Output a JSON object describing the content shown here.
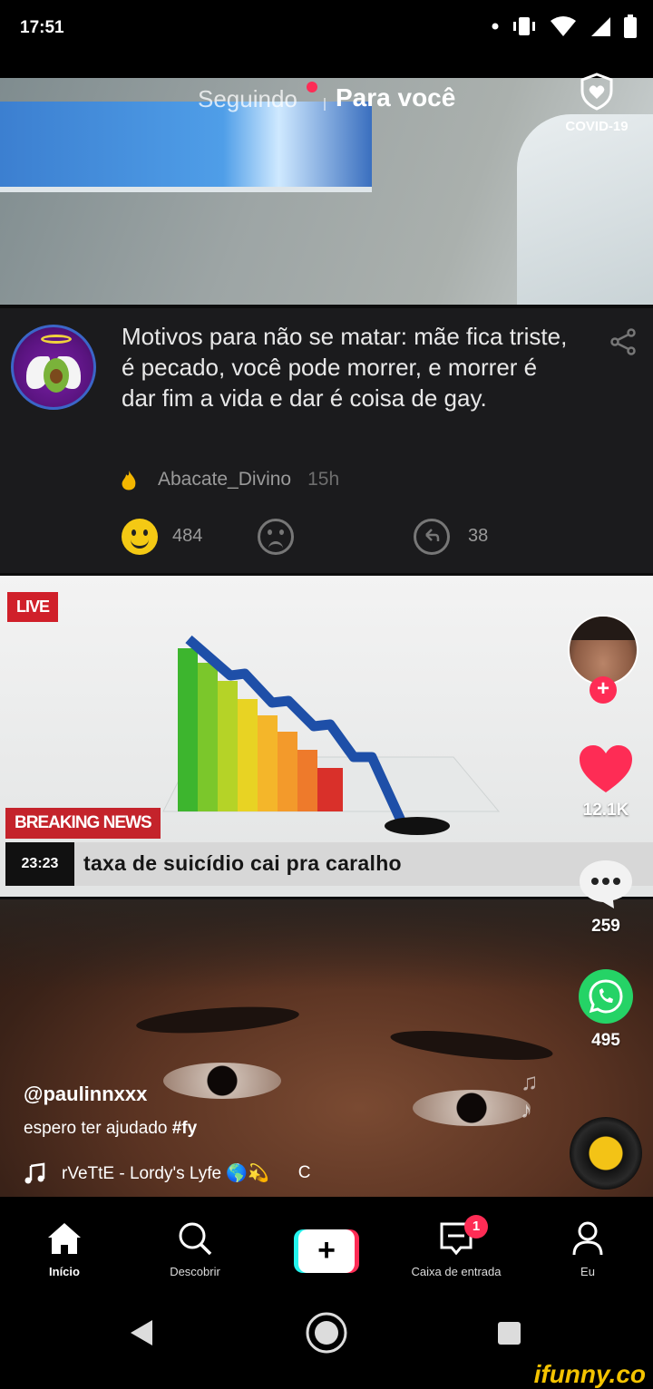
{
  "status_bar": {
    "time": "17:51",
    "battery": "97"
  },
  "top_tabs": {
    "following": "Seguindo",
    "for_you": "Para você",
    "covid_label": "COVID-19"
  },
  "meme": {
    "text": "Motivos para não se matar: mãe fica triste, é pecado, você pode morrer, e morrer é dar fim a vida e dar é coisa de gay.",
    "author": "Abacate_Divino",
    "time": "15h",
    "smile_count": "484",
    "reply_count": "38"
  },
  "news": {
    "live": "LIVE",
    "breaking": "BREAKING NEWS",
    "ticker_time": "23:23",
    "ticker_text": "taxa de suicídio cai pra caralho"
  },
  "rail": {
    "likes": "12.1K",
    "comments": "259",
    "shares": "495"
  },
  "caption": {
    "handle": "@paulinnxxx",
    "description": "espero ter ajudado",
    "hashtag": "#fy",
    "music": "rVeTtE - Lordy's Lyfe 🌎💫",
    "music_tail": "C"
  },
  "nav": {
    "home": "Início",
    "discover": "Descobrir",
    "create": "+",
    "inbox": "Caixa de entrada",
    "inbox_badge": "1",
    "me": "Eu"
  },
  "watermark": "ifunny.co",
  "colors": {
    "accent": "#fe2c55",
    "cyan": "#25f4ee",
    "like": "#fe2c55",
    "whatsapp": "#25d366"
  },
  "icons": [
    "signal-icon",
    "wifi-icon",
    "battery-icon",
    "shield-heart-icon",
    "share-icon",
    "fire-icon",
    "smile-icon",
    "sad-icon",
    "reply-icon",
    "heart-icon",
    "comment-icon",
    "whatsapp-icon",
    "music-note-icon",
    "home-icon",
    "search-icon",
    "inbox-icon",
    "profile-icon",
    "back-icon",
    "home-circle-icon",
    "recents-icon"
  ]
}
